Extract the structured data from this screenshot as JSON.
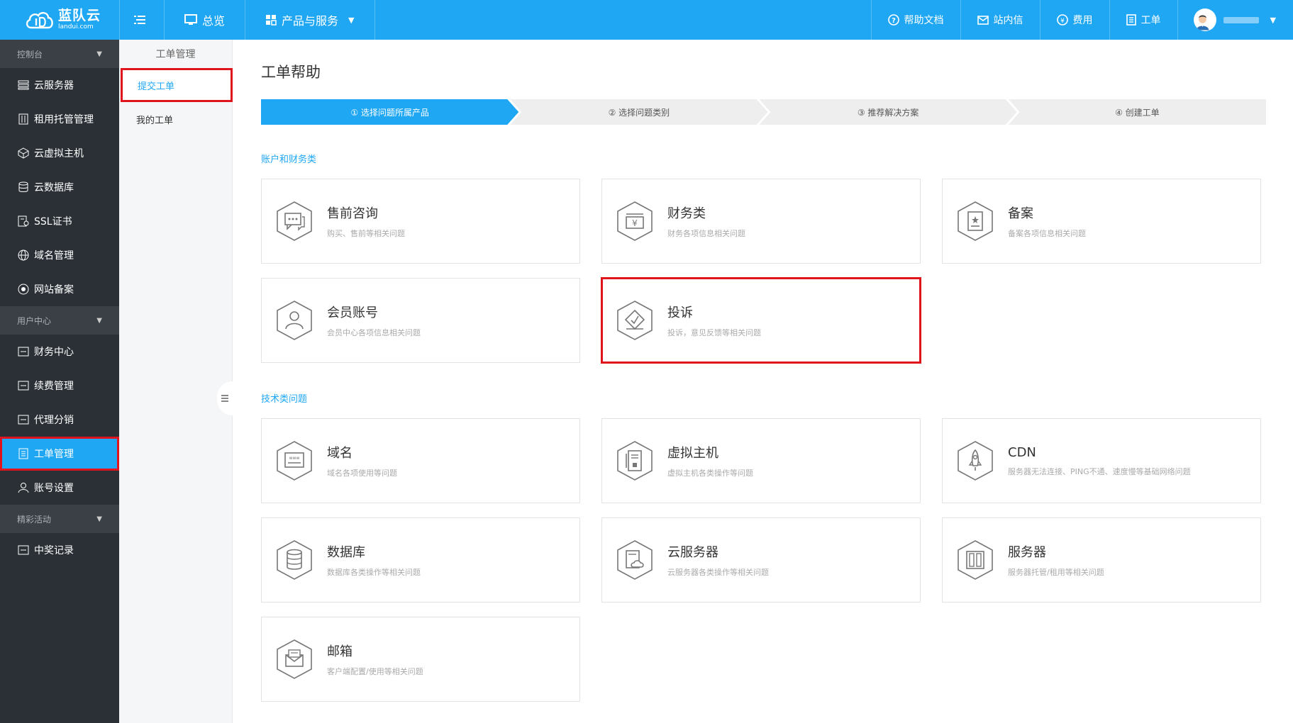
{
  "logo": {
    "cn": "蓝队云",
    "en": "landui.com"
  },
  "topbar": {
    "overview": "总览",
    "products": "产品与服务",
    "help_docs": "帮助文档",
    "messages": "站内信",
    "fees": "费用",
    "tickets": "工单"
  },
  "sidebar": {
    "groups": [
      {
        "label": "控制台"
      },
      {
        "label": "用户中心"
      },
      {
        "label": "精彩活动"
      }
    ],
    "items": [
      {
        "label": "云服务器"
      },
      {
        "label": "租用托管管理"
      },
      {
        "label": "云虚拟主机"
      },
      {
        "label": "云数据库"
      },
      {
        "label": "SSL证书"
      },
      {
        "label": "域名管理"
      },
      {
        "label": "网站备案"
      },
      {
        "label": "财务中心"
      },
      {
        "label": "续费管理"
      },
      {
        "label": "代理分销"
      },
      {
        "label": "工单管理"
      },
      {
        "label": "账号设置"
      },
      {
        "label": "中奖记录"
      }
    ]
  },
  "submenu": {
    "title": "工单管理",
    "items": [
      {
        "label": "提交工单"
      },
      {
        "label": "我的工单"
      }
    ]
  },
  "main": {
    "title": "工单帮助",
    "steps": [
      {
        "label": "① 选择问题所属产品"
      },
      {
        "label": "② 选择问题类别"
      },
      {
        "label": "③ 推荐解决方案"
      },
      {
        "label": "④ 创建工单"
      }
    ],
    "sections": [
      {
        "title": "账户和财务类",
        "cards": [
          {
            "title": "售前咨询",
            "desc": "购买、售前等相关问题",
            "icon": "chat-icon"
          },
          {
            "title": "财务类",
            "desc": "财务各项信息相关问题",
            "icon": "finance-icon"
          },
          {
            "title": "备案",
            "desc": "备案各项信息相关问题",
            "icon": "filing-icon"
          },
          {
            "title": "会员账号",
            "desc": "会员中心各项信息相关问题",
            "icon": "user-icon"
          },
          {
            "title": "投诉",
            "desc": "投诉，意见反馈等相关问题",
            "icon": "complaint-icon"
          }
        ]
      },
      {
        "title": "技术类问题",
        "cards": [
          {
            "title": "域名",
            "desc": "域名各项使用等问题",
            "icon": "www-icon"
          },
          {
            "title": "虚拟主机",
            "desc": "虚拟主机各类操作等问题",
            "icon": "host-icon"
          },
          {
            "title": "CDN",
            "desc": "服务器无法连接、PING不通、速度慢等基础网络问题",
            "icon": "rocket-icon"
          },
          {
            "title": "数据库",
            "desc": "数据库各类操作等相关问题",
            "icon": "database-icon"
          },
          {
            "title": "云服务器",
            "desc": "云服务器各类操作等相关问题",
            "icon": "cloud-server-icon"
          },
          {
            "title": "服务器",
            "desc": "服务器托管/租用等相关问题",
            "icon": "server-icon"
          },
          {
            "title": "邮箱",
            "desc": "客户端配置/使用等相关问题",
            "icon": "mail-icon"
          }
        ]
      }
    ]
  },
  "colors": {
    "brand": "#1fa7f4",
    "sidebar": "#2a3035",
    "highlight": "#e0141c"
  }
}
